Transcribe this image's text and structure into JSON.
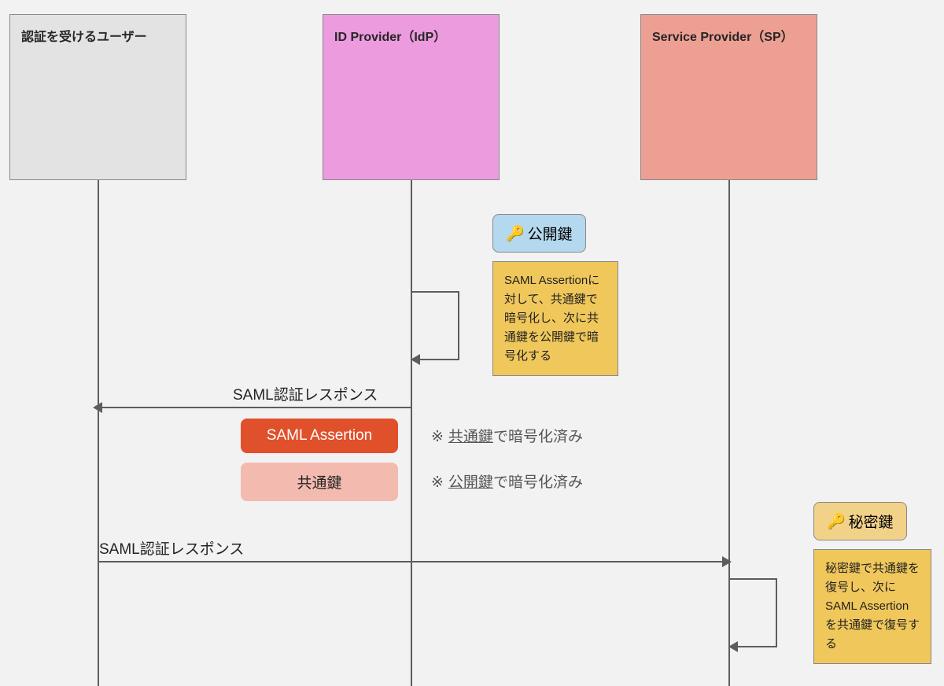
{
  "participants": {
    "user": "認証を受けるユーザー",
    "idp": "ID Provider（IdP）",
    "sp": "Service Provider（SP）"
  },
  "keys": {
    "public": "公開鍵",
    "private": "秘密鍵"
  },
  "notes": {
    "encrypt": "SAML Assertionに対して、共通鍵で暗号化し、次に共通鍵を公開鍵で暗号化する",
    "decrypt": "秘密鍵で共通鍵を復号し、次に SAML Assertionを共通鍵で復号する"
  },
  "messages": {
    "m1": "SAML認証レスポンス",
    "m2": "SAML認証レスポンス"
  },
  "chips": {
    "assertion": "SAML Assertion",
    "shared": "共通鍵"
  },
  "annotations": {
    "a1_star": "※",
    "a1_key": "共通鍵",
    "a1_rest": "で暗号化済み",
    "a2_star": "※",
    "a2_key": "公開鍵",
    "a2_rest": "で暗号化済み"
  },
  "icons": {
    "key": "🔑"
  }
}
